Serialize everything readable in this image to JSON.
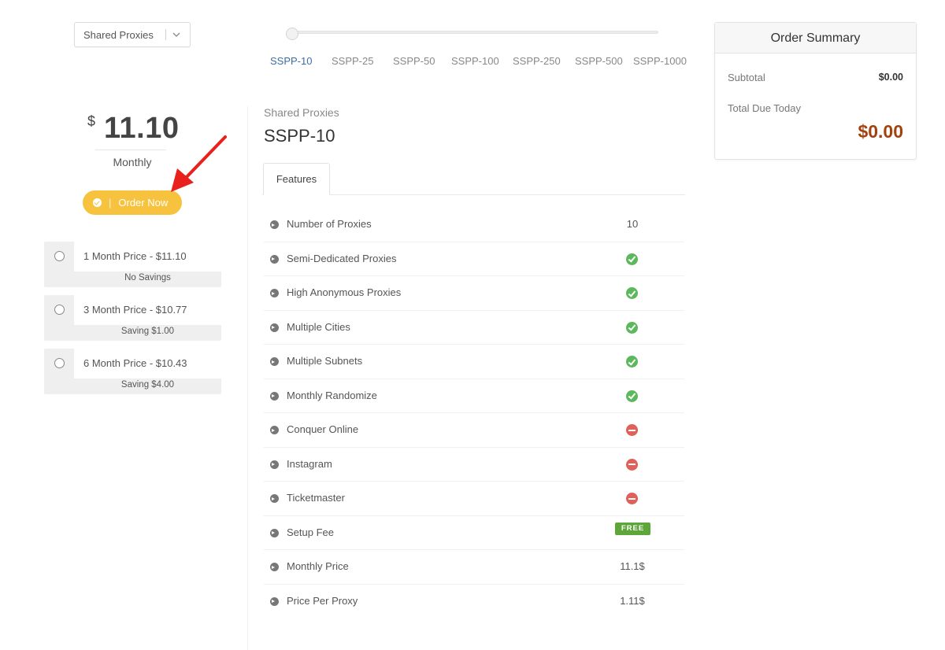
{
  "category_select": {
    "value": "Shared Proxies"
  },
  "slider": {
    "tiers": [
      "SSPP-10",
      "SSPP-25",
      "SSPP-50",
      "SSPP-100",
      "SSPP-250",
      "SSPP-500",
      "SSPP-1000"
    ],
    "selected": "SSPP-10"
  },
  "price": {
    "currency": "$",
    "amount": "11.10",
    "period": "Monthly"
  },
  "order_button": {
    "label": "Order Now",
    "separator": "|"
  },
  "billing_options": [
    {
      "label": "1 Month Price - $11.10",
      "note": "No Savings"
    },
    {
      "label": "3 Month Price - $10.77",
      "note": "Saving $1.00"
    },
    {
      "label": "6 Month Price - $10.43",
      "note": "Saving $4.00"
    }
  ],
  "product": {
    "category": "Shared Proxies",
    "name": "SSPP-10"
  },
  "tabs": [
    {
      "label": "Features"
    }
  ],
  "features": [
    {
      "label": "Number of Proxies",
      "value": "10"
    },
    {
      "label": "Semi-Dedicated Proxies",
      "status": "yes"
    },
    {
      "label": "High Anonymous Proxies",
      "status": "yes"
    },
    {
      "label": "Multiple Cities",
      "status": "yes"
    },
    {
      "label": "Multiple Subnets",
      "status": "yes"
    },
    {
      "label": "Monthly Randomize",
      "status": "yes"
    },
    {
      "label": "Conquer Online",
      "status": "no"
    },
    {
      "label": "Instagram",
      "status": "no"
    },
    {
      "label": "Ticketmaster",
      "status": "no"
    },
    {
      "label": "Setup Fee",
      "badge": "FREE"
    },
    {
      "label": "Monthly Price",
      "value": "11.1$"
    },
    {
      "label": "Price Per Proxy",
      "value": "1.11$"
    }
  ],
  "order_summary": {
    "title": "Order Summary",
    "subtotal_label": "Subtotal",
    "subtotal_value": "$0.00",
    "total_label": "Total Due Today",
    "total_value": "$0.00"
  },
  "colors": {
    "accent_button": "#f7c23d",
    "active_tier": "#3a6ea5",
    "total_due": "#a3420f",
    "check": "#5cb85c",
    "cross": "#e0605a",
    "free_badge": "#5ea63a",
    "annotation_arrow": "#e8211d"
  },
  "icons": {
    "dropdown_caret": "chevron-down-icon",
    "order_button": "check-circle-icon",
    "feature_bullet": "arrow-circle-right-icon",
    "feature_yes": "check-circle-icon",
    "feature_no": "minus-circle-icon",
    "annotation": "red-arrow"
  }
}
